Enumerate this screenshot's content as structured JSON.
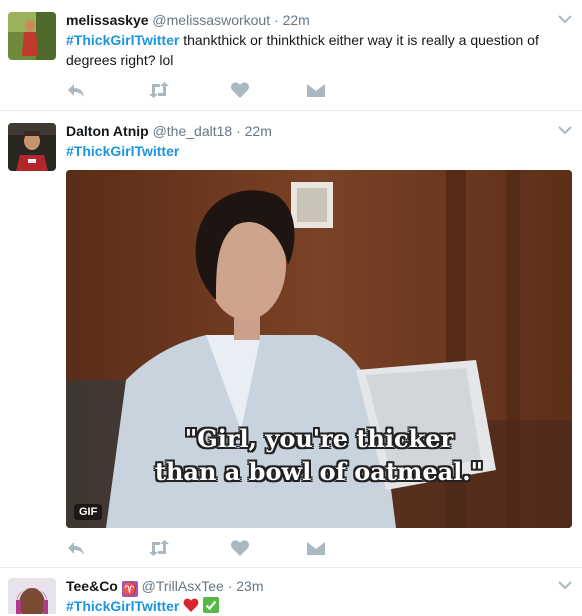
{
  "tweets": [
    {
      "fullname": "melissaskye",
      "handle": "@melissasworkout",
      "dot": "·",
      "time": "22m",
      "hashtag": "#ThickGirlTwitter",
      "text": " thankthick or thinkthick either way it is really a question of degrees right? lol"
    },
    {
      "fullname": "Dalton Atnip",
      "handle": "@the_dalt18",
      "dot": "·",
      "time": "22m",
      "hashtag": "#ThickGirlTwitter",
      "media": {
        "badge": "GIF",
        "caption_line1": "\"Girl, you're thicker",
        "caption_line2": "than a bowl of oatmeal.\""
      }
    },
    {
      "fullname": "Tee&Co",
      "handle": "@TrillAsxTee",
      "dot": "·",
      "time": "23m",
      "hashtag": "#ThickGirlTwitter"
    }
  ],
  "icons": {
    "reply": "reply-icon",
    "retweet": "retweet-icon",
    "like": "heart-icon",
    "dm": "direct-message-icon",
    "caret": "chevron-down-icon",
    "aries": "aries-emoji",
    "heart_emoji": "red-heart-emoji",
    "check_emoji": "check-mark-emoji"
  },
  "colors": {
    "link": "#1b95e0",
    "muted": "#657786",
    "action": "#aab8c2",
    "border": "#e6ecf0"
  }
}
